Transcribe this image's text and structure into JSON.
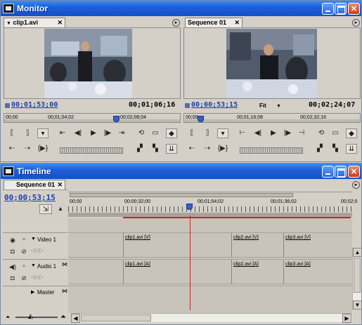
{
  "monitor": {
    "title": "Monitor",
    "source_tab": "clip1.avi",
    "program_tab": "Sequence 01",
    "source_timecode": "00;01;53;00",
    "source_duration": "00;01;06;16",
    "source_ruler": [
      "00;00",
      "00;01;04;02",
      "00;02;08;04"
    ],
    "program_timecode": "00;00;53;15",
    "program_zoom": "Fit",
    "program_duration": "00;02;24;07",
    "program_ruler": [
      "00;00",
      "00;01;16;08",
      "00;02;32;16"
    ]
  },
  "timeline": {
    "title": "Timeline",
    "sequence_tab": "Sequence 01",
    "current_time": "00;00;53;15",
    "ruler": [
      "00;00",
      "00;00;32;00",
      "00;01;04;02",
      "00;01;36;02",
      "00;02;0"
    ],
    "tracks": [
      {
        "name": "Video 1",
        "clips": [
          "clip1.avi [V]",
          "clip2.avi [V]",
          "clip3.avi [V]"
        ]
      },
      {
        "name": "Audio 1",
        "clips": [
          "clip1.avi [A]",
          "clip2.avi [A]",
          "clip3.avi [A]"
        ]
      },
      {
        "name": "Master",
        "clips": []
      }
    ]
  },
  "colors": {
    "titlebar": "#1d5fd8",
    "playhead": "#e02020",
    "timecode": "#1a3fb0"
  }
}
